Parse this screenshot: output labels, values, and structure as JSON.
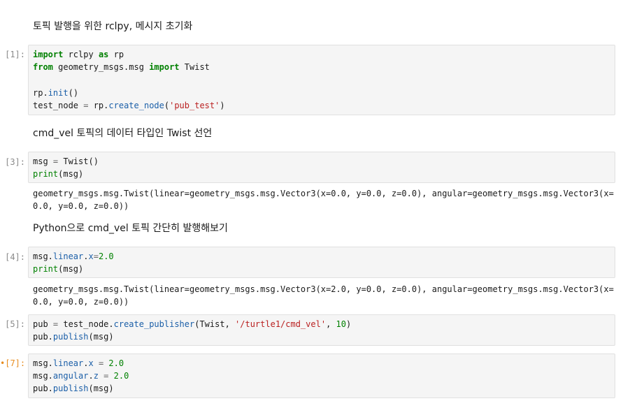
{
  "cells": {
    "md1": "토픽 발행을 위한 rclpy, 메시지 초기화",
    "c1_prompt": "[1]:",
    "md2": "cmd_vel 토픽의 데이터 타입인 Twist 선언",
    "c3_prompt": "[3]:",
    "out3_line1": "geometry_msgs.msg.Twist(linear=geometry_msgs.msg.Vector3(x=0.0, y=0.0, z=0.0), angular=geometry_msgs.msg.Vector3(x=",
    "out3_line2": "0.0, y=0.0, z=0.0))",
    "md3": "Python으로 cmd_vel 토픽 간단히 발행해보기",
    "c4_prompt": "[4]:",
    "out4_line1": "geometry_msgs.msg.Twist(linear=geometry_msgs.msg.Vector3(x=2.0, y=0.0, z=0.0), angular=geometry_msgs.msg.Vector3(x=",
    "out4_line2": "0.0, y=0.0, z=0.0))",
    "c5_prompt": "[5]:",
    "c7_dot": "•",
    "c7_prompt": "[7]:"
  },
  "tokens": {
    "import": "import",
    "rclpy": " rclpy ",
    "as": "as",
    "rp": " rp",
    "from": "from",
    "gm": " geometry_msgs.msg ",
    "Twist": " Twist",
    "rp_init_a": "rp.",
    "init": "init",
    "paren": "()",
    "test_node_eq": "test_node ",
    "eq": "=",
    "rp2": " rp.",
    "create_node": "create_node",
    "lp": "(",
    "pub_test": "'pub_test'",
    "rp_paren": ")",
    "msg": "msg ",
    "twist_call": " Twist()",
    "print": "print",
    "msg_arg": "(msg)",
    "msg_dot": "msg.",
    "linear": "linear",
    "dot": ".",
    "x": "x",
    "two": "2.0",
    "pub": "pub ",
    "test_node_dot": " test_node.",
    "create_publisher": "create_publisher",
    "twist_arg": "(Twist, ",
    "topic": "'/turtle1/cmd_vel'",
    "comma": ", ",
    "ten": "10",
    "pub_dot": "pub.",
    "publish": "publish",
    "angular": "angular",
    "z": "z",
    "sp": " ",
    "sp_eq": " = "
  }
}
